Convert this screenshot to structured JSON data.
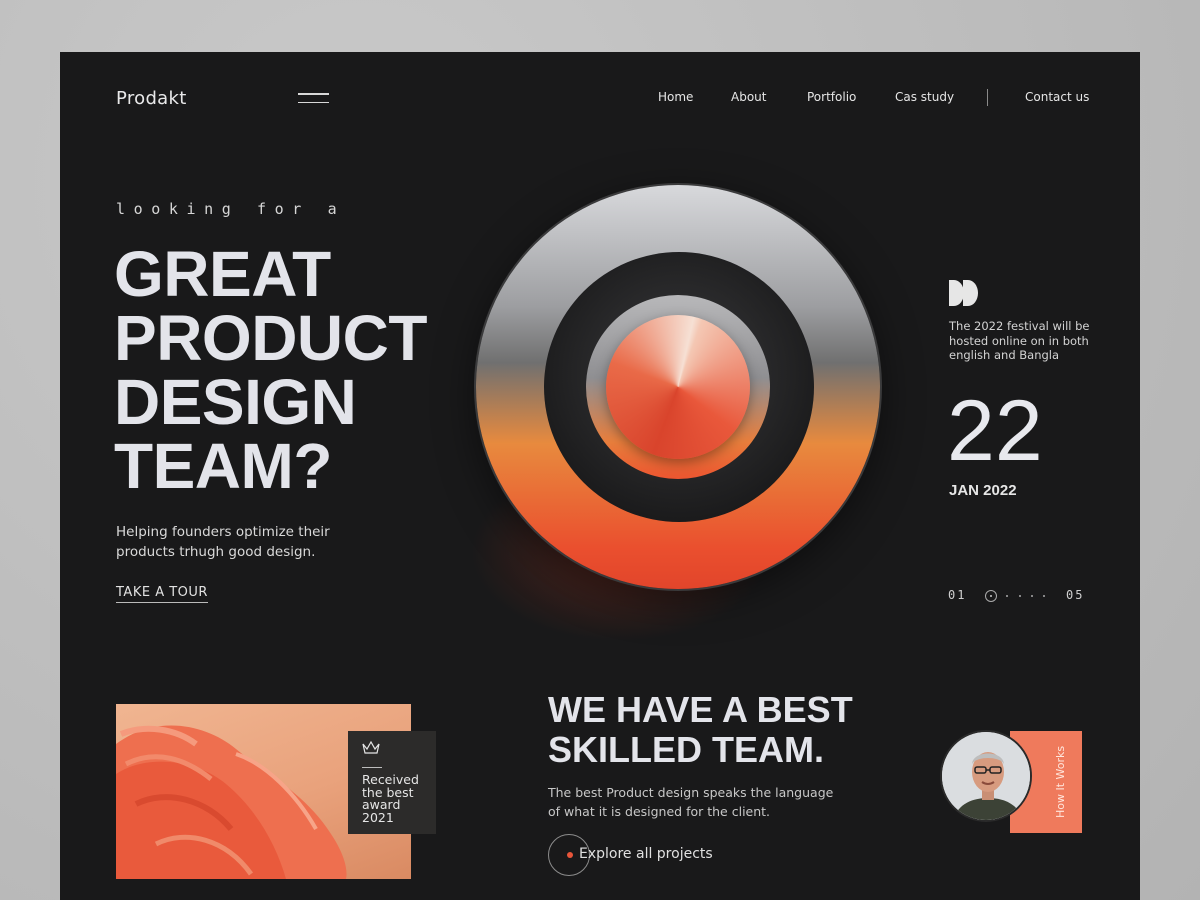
{
  "header": {
    "logo": "Prodakt",
    "nav": [
      "Home",
      "About",
      "Portfolio",
      "Cas study",
      "Contact us"
    ]
  },
  "hero": {
    "eyebrow": "looking for a",
    "headline": [
      "GREAT",
      "PRODUCT",
      "DESIGN",
      "TEAM?"
    ],
    "subtitle": "Helping founders optimize their products trhugh good design.",
    "cta": "TAKE A TOUR"
  },
  "event": {
    "description": "The 2022 festival will be hosted online on in both english and Bangla",
    "day": "22",
    "month": "JAN 2022"
  },
  "pager": {
    "start": "01",
    "end": "05"
  },
  "award": {
    "text": [
      "Received",
      "the best",
      "award",
      "2021"
    ]
  },
  "team": {
    "title": [
      "WE HAVE A BEST",
      "SKILLED TEAM."
    ],
    "subtitle": "The best Product design speaks the language of what it is designed for the client.",
    "cta": "Explore all projects",
    "side_label": "How It Works"
  },
  "colors": {
    "accent": "#ef7a5c",
    "background": "#19191a",
    "text": "#e3e4ea"
  }
}
